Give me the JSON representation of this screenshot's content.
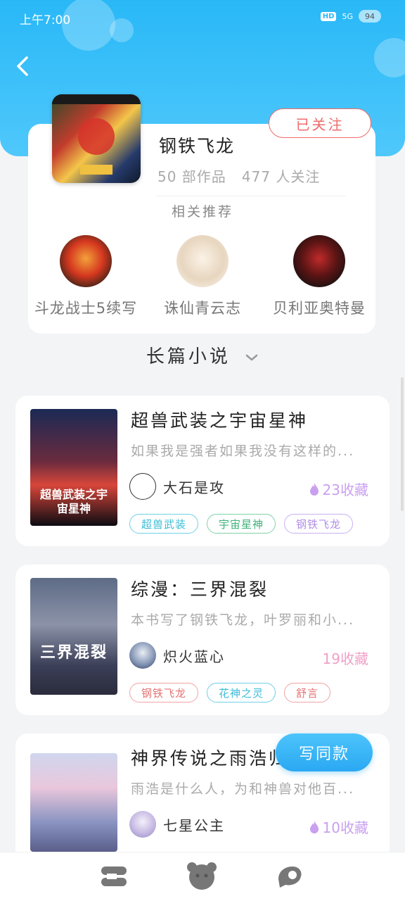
{
  "status_bar": {
    "time": "上午7:00",
    "hd": "HD",
    "network": "5G",
    "battery": "94"
  },
  "author": {
    "name": "钢铁飞龙",
    "works": "50 部作品",
    "followers": "477 人关注",
    "follow_button": "已关注"
  },
  "related": {
    "title": "相关推荐",
    "items": [
      {
        "name": "斗龙战士5续写"
      },
      {
        "name": "诛仙青云志"
      },
      {
        "name": "贝利亚奥特曼"
      }
    ]
  },
  "section": {
    "title": "长篇小说"
  },
  "novels": [
    {
      "title": "超兽武装之宇宙星神",
      "description": "如果我是强者如果我没有这样的...",
      "author": "大石是攻",
      "favorites": "23收藏",
      "cover_text": "超兽武装之宇宙星神",
      "tags": [
        "超兽武装",
        "宇宙星神",
        "钢铁飞龙"
      ]
    },
    {
      "title": "综漫：三界混裂",
      "description": "本书写了钢铁飞龙，叶罗丽和小...",
      "author": "炽火蓝心",
      "favorites": "19收藏",
      "cover_text": "三界混裂",
      "tags": [
        "钢铁飞龙",
        "花神之灵",
        "舒言"
      ]
    },
    {
      "title": "神界传说之雨浩归来",
      "description": "雨浩是什么人，为和神兽对他百...",
      "author": "七星公主",
      "favorites": "10收藏",
      "tags": []
    }
  ],
  "fab": {
    "label": "写同款"
  },
  "icons": {
    "back": "back-arrow-icon",
    "chevron": "chevron-down-icon",
    "flame": "flame-icon",
    "nav": [
      "home-icon",
      "bear-icon",
      "message-icon"
    ]
  },
  "colors": {
    "header": "#29b8f7",
    "follow": "#ef6b6b",
    "fav": "#c9a0f0"
  }
}
